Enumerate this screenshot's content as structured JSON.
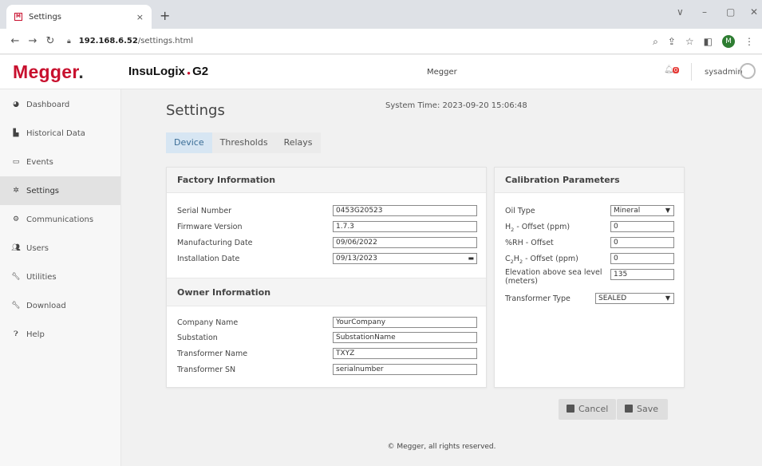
{
  "browser": {
    "tab_title": "Settings",
    "tab_close": "×",
    "new_tab": "+",
    "url_host": "192.168.6.52",
    "url_path": "/settings.html",
    "profile_initial": "M",
    "window_controls": [
      "∨",
      "–",
      "▢",
      "✕"
    ]
  },
  "header": {
    "logo": "Megger",
    "logo_dot": ".",
    "product": "InsuLogix",
    "product_suffix": "G2",
    "center_title": "Megger",
    "notification_count": "0",
    "user": "sysadmin"
  },
  "sidebar": {
    "items": [
      {
        "label": "Dashboard",
        "icon": "dashboard-icon"
      },
      {
        "label": "Historical Data",
        "icon": "chart-icon"
      },
      {
        "label": "Events",
        "icon": "monitor-icon"
      },
      {
        "label": "Settings",
        "icon": "gear-icon"
      },
      {
        "label": "Communications",
        "icon": "gears-icon"
      },
      {
        "label": "Users",
        "icon": "users-icon"
      },
      {
        "label": "Utilities",
        "icon": "wrench-icon"
      },
      {
        "label": "Download",
        "icon": "wrench-icon"
      },
      {
        "label": "Help",
        "icon": "question-icon"
      }
    ]
  },
  "main": {
    "title": "Settings",
    "system_time": "System Time: 2023-09-20 15:06:48",
    "tabs": [
      "Device",
      "Thresholds",
      "Relays"
    ],
    "factory": {
      "heading": "Factory Information",
      "serial_label": "Serial Number",
      "serial_value": "0453G20523",
      "firmware_label": "Firmware Version",
      "firmware_value": "1.7.3",
      "mfg_label": "Manufacturing Date",
      "mfg_value": "09/06/2022",
      "install_label": "Installation Date",
      "install_value": "09/13/2023"
    },
    "owner": {
      "heading": "Owner Information",
      "company_label": "Company Name",
      "company_value": "YourCompany",
      "substation_label": "Substation",
      "substation_value": "SubstationName",
      "tname_label": "Transformer Name",
      "tname_value": "TXYZ",
      "tsn_label": "Transformer SN",
      "tsn_value": "serialnumber"
    },
    "calibration": {
      "heading": "Calibration Parameters",
      "oil_label": "Oil Type",
      "oil_value": "Mineral",
      "h2_label_a": "H",
      "h2_label_sub": "2",
      "h2_label_b": " - Offset (ppm)",
      "h2_value": "0",
      "rh_label": "%RH - Offset",
      "rh_value": "0",
      "c2h2_label_a": "C",
      "c2h2_sub1": "2",
      "c2h2_label_b": "H",
      "c2h2_sub2": "2",
      "c2h2_label_c": " - Offset (ppm)",
      "c2h2_value": "0",
      "elev_label": "Elevation above sea level (meters)",
      "elev_value": "135",
      "ttype_label": "Transformer Type",
      "ttype_value": "SEALED"
    },
    "cancel": "Cancel",
    "save": "Save"
  },
  "footer": "© Megger, all rights reserved."
}
